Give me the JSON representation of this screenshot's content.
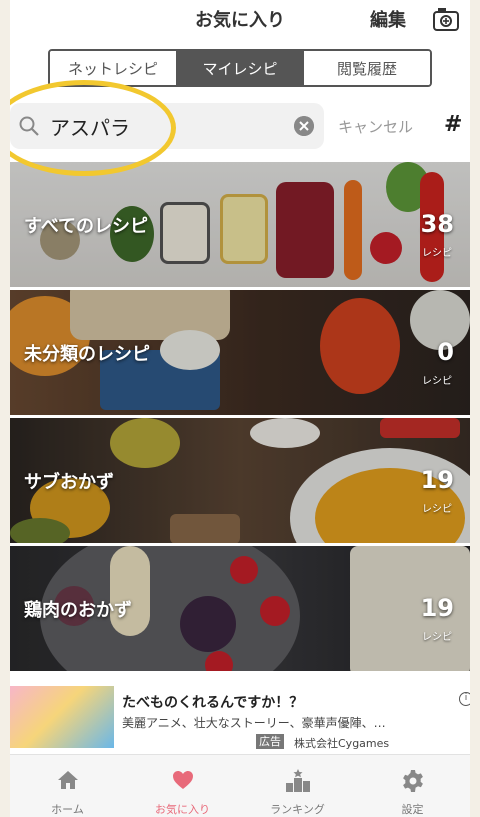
{
  "header": {
    "title": "お気に入り",
    "edit_label": "編集"
  },
  "segments": [
    {
      "label": "ネットレシピ",
      "active": false
    },
    {
      "label": "マイレシピ",
      "active": true
    },
    {
      "label": "閲覧履歴",
      "active": false
    }
  ],
  "search": {
    "value": "アスパラ",
    "cancel_label": "キャンセル",
    "hash_label": "#"
  },
  "categories": [
    {
      "name": "すべてのレシピ",
      "count": "38",
      "unit": "レシピ"
    },
    {
      "name": "未分類のレシピ",
      "count": "0",
      "unit": "レシピ"
    },
    {
      "name": "サブおかず",
      "count": "19",
      "unit": "レシピ"
    },
    {
      "name": "鶏肉のおかず",
      "count": "19",
      "unit": "レシピ"
    }
  ],
  "ad": {
    "title": "たべものくれるんですか！？",
    "description": "美麗アニメ、壮大なストーリー、豪華声優陣、…",
    "badge": "広告",
    "company": "株式会社Cygames",
    "info": "i"
  },
  "tabbar": [
    {
      "label": "ホーム",
      "icon": "home-icon",
      "active": false
    },
    {
      "label": "お気に入り",
      "icon": "heart-icon",
      "active": true
    },
    {
      "label": "ランキング",
      "icon": "ranking-icon",
      "active": false
    },
    {
      "label": "設定",
      "icon": "gear-icon",
      "active": false
    }
  ],
  "colors": {
    "accent": "#e86a7a",
    "annotation": "#f2c82f"
  }
}
